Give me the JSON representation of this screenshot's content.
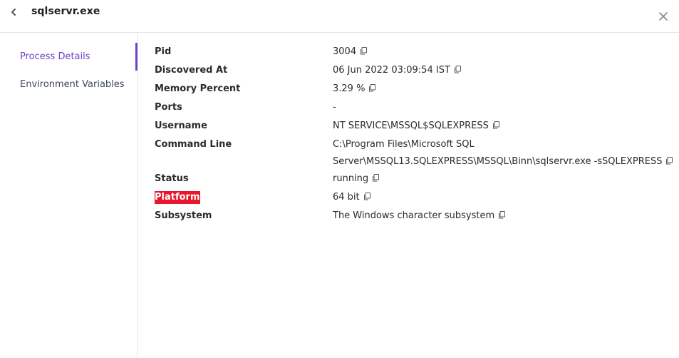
{
  "header": {
    "title": "sqlservr.exe",
    "back_icon": "chevron-left-icon",
    "close_icon": "close-icon"
  },
  "sidebar": {
    "items": [
      {
        "label": "Process Details",
        "active": true
      },
      {
        "label": "Environment Variables",
        "active": false
      }
    ],
    "accent_color": "#6a43c9"
  },
  "details": {
    "rows": [
      {
        "label": "Pid",
        "value": "3004"
      },
      {
        "label": "Discovered At",
        "value": "06 Jun 2022 03:09:54 IST"
      },
      {
        "label": "Memory Percent",
        "value": "3.29 %"
      },
      {
        "label": "Ports",
        "value": "-"
      },
      {
        "label": "Username",
        "value": "NT SERVICE\\MSSQL$SQLEXPRESS"
      },
      {
        "label": "Command Line",
        "value_line1": "C:\\Program Files\\Microsoft SQL",
        "value_line2": "Server\\MSSQL13.SQLEXPRESS\\MSSQL\\Binn\\sqlservr.exe -sSQLEXPRESS"
      },
      {
        "label": "Status",
        "value": "running"
      },
      {
        "label": "Platform",
        "value": "64 bit",
        "highlighted": true
      },
      {
        "label": "Subsystem",
        "value": "The Windows character subsystem"
      }
    ],
    "highlight_color": "#e8182c",
    "copy_icon": "copy-icon"
  }
}
